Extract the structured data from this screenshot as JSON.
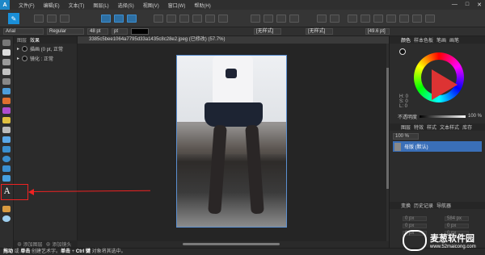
{
  "menubar": {
    "app_logo": "A",
    "items": [
      "文件(F)",
      "编辑(E)",
      "文本(T)",
      "图层(L)",
      "选择(S)",
      "视图(V)",
      "窗口(W)",
      "帮助(H)"
    ],
    "window_buttons": [
      "—",
      "□",
      "✕"
    ]
  },
  "context_bar": {
    "font": "Arial",
    "style": "Regular",
    "size": "48 pt",
    "unit": "pt",
    "fill_label": "[无样式]",
    "fill_label2": "[无样式]",
    "right_field": "[49.6 pt]"
  },
  "layers_panel": {
    "tabs": [
      "图层",
      "效果"
    ],
    "layers": [
      {
        "name": "描画 (0 pt, 正常"
      },
      {
        "name": "镜化 : 正常"
      }
    ],
    "footer": [
      "⊕ 添加图层",
      "⊕ 添加镜头"
    ]
  },
  "document": {
    "tab_title": "3385c5bee1064a7795d33a1435c8c28e2.jpeg (已修改) (57.7%)"
  },
  "right_panel": {
    "tabs": [
      "颜色",
      "样本色板",
      "笔画",
      "画笔"
    ],
    "hsl": [
      "H: 0",
      "S: 0",
      "L: 0"
    ],
    "opacity_label": "不透明度",
    "opacity_value": "100 %",
    "pages_tabs": [
      "图层",
      "特效",
      "样式",
      "文本样式",
      "库存"
    ],
    "pages_zoom": "100 %",
    "page_item_label": "母版 (默认)",
    "transform_tabs": [
      "变换",
      "历史记录",
      "导航器"
    ],
    "transform_fields": [
      "0 px",
      "584 px",
      "0 px",
      "0 px",
      "0 px",
      "0 px"
    ]
  },
  "statusbar": {
    "text_prefix": "拖动",
    "text_mid": " 或 ",
    "text_click": "单击",
    "text_rest": " 创建艺术字。",
    "text_click2": "单击",
    "text_plus": " + ",
    "text_ctrl": "Ctrl 键",
    "text_end": " 对象将其选中。"
  },
  "watermark": {
    "title": "麦葱软件园",
    "url": "www.52maicong.com"
  },
  "colors": {
    "accent": "#1e88c8",
    "selection": "#3a6fb8",
    "annotation": "#e22222"
  }
}
